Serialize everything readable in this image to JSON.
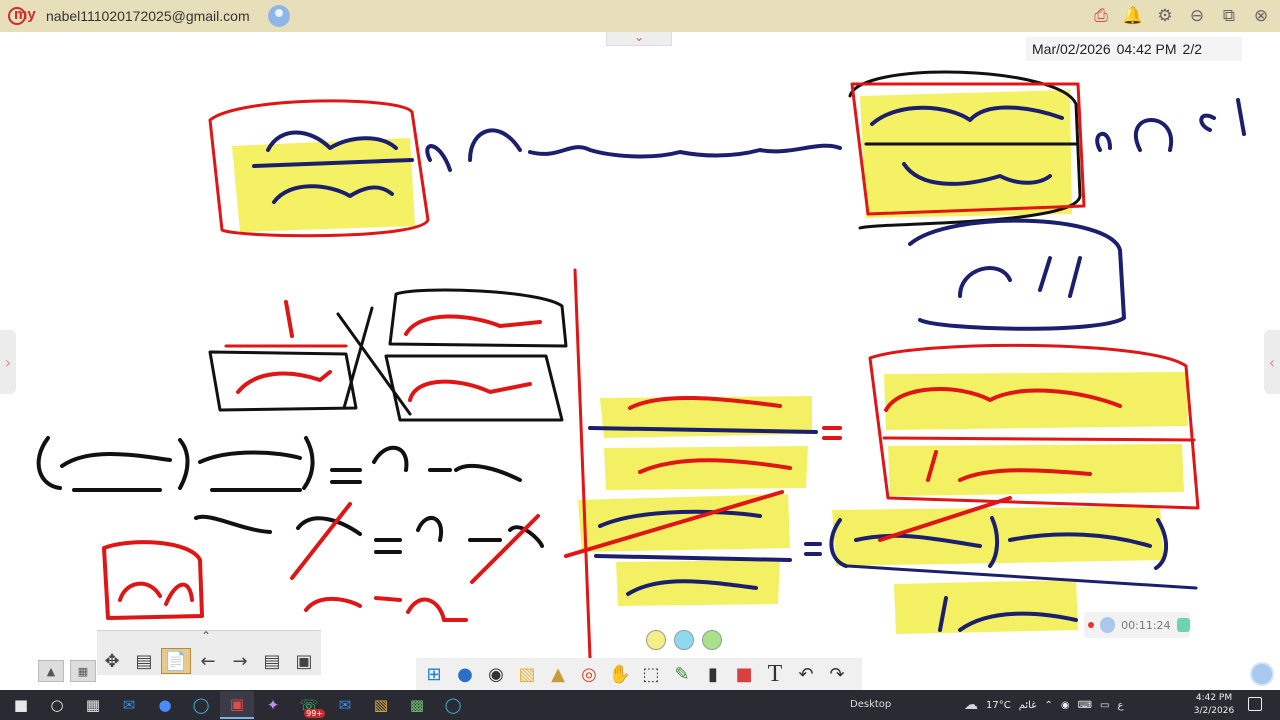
{
  "titlebar": {
    "app_logo_text": "my",
    "account_email": "nabel111020172025@gmail.com",
    "icons": [
      "recorder-icon",
      "bell-icon",
      "gear-icon",
      "minimize-icon",
      "restore-icon",
      "close-icon"
    ]
  },
  "stamp": {
    "date": "Mar/02/2026",
    "time": "04:42 PM",
    "page": "2/2"
  },
  "colors": {
    "title_bar": "#e7dfba",
    "ink_blue": "#1b1f6e",
    "ink_red": "#e01515",
    "ink_black": "#111111",
    "highlight": "#f3ee4a",
    "taskbar": "#2a2a33"
  },
  "board": {
    "handwriting_top": "ن (س) = (س² − ٤س + ٤) / (س² − م) ابسط صورة ن (س) = (س − ٢) / (س + ٢)",
    "handwriting_box": "اوجد م",
    "left_work": [
      "١ / (س + ٢)",
      "(س − ٢) / (س² − م)",
      "(س − ٢)(س + ٢) = س² − م",
      "س² − ٤ = س² − م",
      "م = ٤",
      "− م = − ٤"
    ],
    "right_work": [
      "(س² − ٤س + ٤) / (س² − م) = (س − ٢) / (س + ٢)",
      "(س − ٢)(س − ٢) / (س² − م) = (س − ٢) / (س + ٢)"
    ]
  },
  "toolbars": {
    "left": [
      "move-icon",
      "export-icon",
      "document-icon",
      "arrow-left-icon",
      "arrow-right-icon",
      "add-page-icon",
      "help-page-icon"
    ],
    "mini": [
      "image-icon",
      "gallery-icon"
    ],
    "colors": [
      "#f3ee85",
      "#8ed8f0",
      "#a8e08c"
    ],
    "main": [
      "windows-icon",
      "users-icon",
      "camera-icon",
      "folder-icon",
      "box-icon",
      "chrome-icon",
      "hand-icon",
      "select-icon",
      "marker-icon",
      "eraser-icon",
      "shapes-icon",
      "text-icon",
      "undo-icon",
      "redo-icon"
    ],
    "text_tool_label": "T"
  },
  "recorder": {
    "time": "00:11:24"
  },
  "taskbar": {
    "items": [
      "start-icon",
      "search-icon",
      "taskview-icon",
      "outlook-icon",
      "zoom-icon",
      "edge-icon",
      "myviewboard-icon",
      "copilot-icon",
      "whatsapp-icon",
      "mail-icon",
      "files-icon",
      "photos-icon",
      "edge-icon-2"
    ],
    "whatsapp_badge": "99+",
    "desktop_label": "Desktop",
    "weather_temp": "17°C",
    "weather_text": "غائم",
    "lang": "ع",
    "time": "4:42 PM",
    "date": "3/2/2026"
  }
}
